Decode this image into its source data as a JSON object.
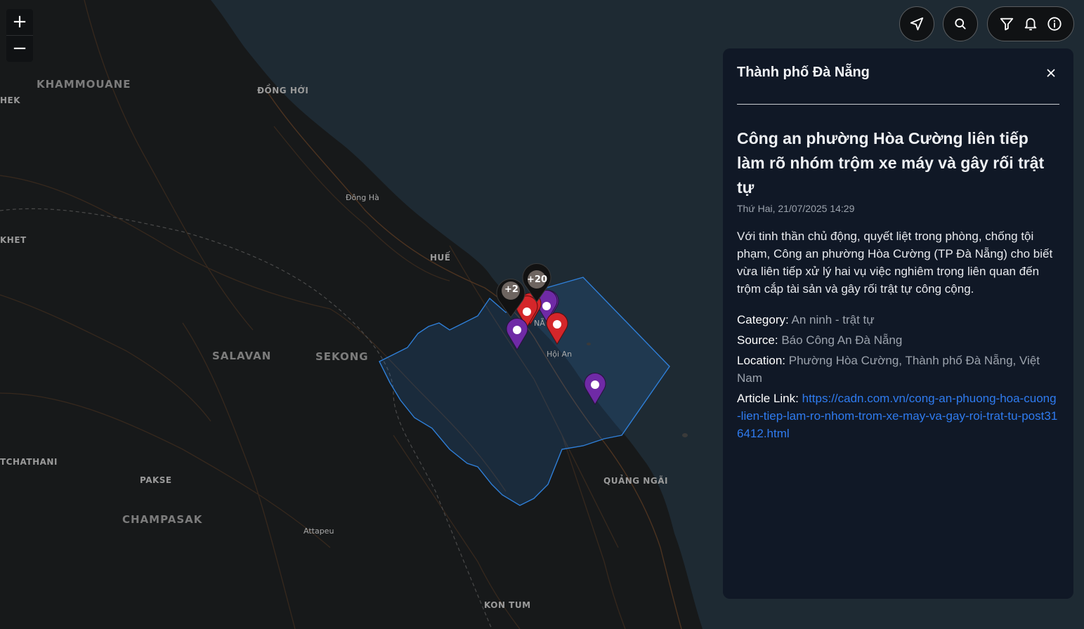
{
  "map": {
    "labels": {
      "khammouane": "KHAMMOUANE",
      "hek": "HEK",
      "dong_hoi": "ĐỒNG HỚI",
      "dong_ha": "Đông Hà",
      "khet": "KHET",
      "hue": "HUẾ",
      "salavan": "SALAVAN",
      "sekong": "SEKONG",
      "da_nang": "NẴ",
      "hoi_an": "Hội An",
      "champasak_edge": "TCHATHANI",
      "pakse": "PAKSE",
      "champasak": "CHAMPASAK",
      "attapeu": "Attapeu",
      "quang_ngai": "QUẢNG NGÃI",
      "kon_tum": "KON TUM"
    },
    "clusters": [
      {
        "count": "+20"
      },
      {
        "count": "+2"
      }
    ],
    "colors": {
      "water": "#1e2a33",
      "land": "#17191a",
      "boundary": "#2f7fd8",
      "marker_red": "#d4262a",
      "marker_purple": "#6f2aa6",
      "cluster": "#6e6560"
    }
  },
  "zoom": {
    "in_label": "+",
    "out_label": "−"
  },
  "controls": {
    "locate": "locate-arrow-icon",
    "search": "search-icon",
    "filter": "filter-icon",
    "notifications": "bell-icon",
    "info": "info-icon"
  },
  "panel": {
    "title": "Thành phố Đà Nẵng",
    "headline": "Công an phường Hòa Cường liên tiếp làm rõ nhóm trộm xe máy và gây rối trật tự",
    "date": "Thứ Hai, 21/07/2025 14:29",
    "summary": "Với tinh thần chủ động, quyết liệt trong phòng, chống tội phạm, Công an phường Hòa Cường (TP Đà Nẵng) cho biết vừa liên tiếp xử lý hai vụ việc nghiêm trọng liên quan đến trộm cắp tài sản và gây rối trật tự công cộng.",
    "category_label": "Category:",
    "category_value": "An ninh - trật tự",
    "source_label": "Source:",
    "source_value": "Báo Công An Đà Nẵng",
    "location_label": "Location:",
    "location_value": "Phường Hòa Cường, Thành phố Đà Nẵng, Việt Nam",
    "link_label": "Article Link:",
    "link_value": "https://cadn.com.vn/cong-an-phuong-hoa-cuong-lien-tiep-lam-ro-nhom-trom-xe-may-va-gay-roi-trat-tu-post316412.html"
  }
}
